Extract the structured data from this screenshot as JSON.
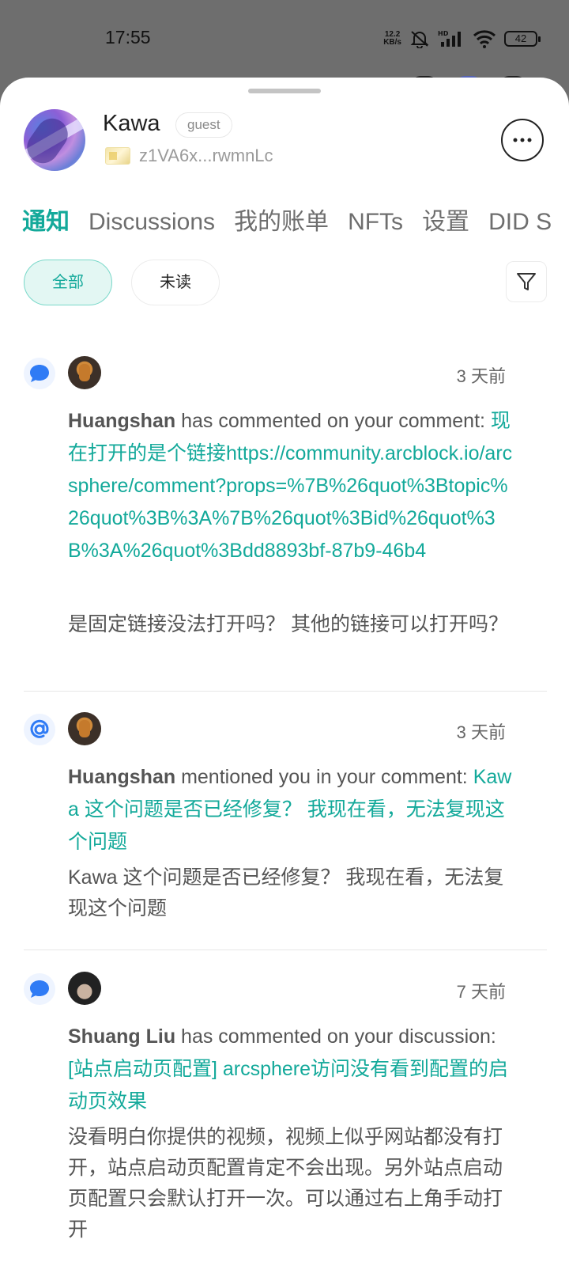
{
  "status_bar": {
    "time": "17:55",
    "net_speed_value": "12.2",
    "net_speed_unit": "KB/s",
    "battery": "42",
    "icons": [
      "mute-bell-icon",
      "hd-signal-icon",
      "wifi-icon",
      "battery-icon"
    ]
  },
  "profile": {
    "name": "Kawa",
    "role": "guest",
    "did_address": "z1VA6x...rwmnLc"
  },
  "tabs": [
    "通知",
    "Discussions",
    "我的账单",
    "NFTs",
    "设置",
    "DID S"
  ],
  "active_tab": "通知",
  "filters": {
    "all_label": "全部",
    "unread_label": "未读",
    "selected": "全部"
  },
  "notifications": [
    {
      "type_icon": "comment-icon",
      "time": "3 天前",
      "actor": "Huangshan",
      "action": " has commented on your comment: ",
      "link_text": "现在打开的是个链接https://community.arcblock.io/arcsphere/comment?props=%7B%26quot%3Btopic%26quot%3B%3A%7B%26quot%3Bid%26quot%3B%3A%26quot%3Bdd8893bf-87b9-46b4",
      "excerpt": "是固定链接没法打开吗？ 其他的链接可以打开吗？"
    },
    {
      "type_icon": "mention-icon",
      "time": "3 天前",
      "actor": "Huangshan",
      "action": " mentioned you in your comment: ",
      "link_text": "Kawa 这个问题是否已经修复？ 我现在看，无法复现这个问题",
      "excerpt": "Kawa 这个问题是否已经修复？ 我现在看，无法复现这个问题"
    },
    {
      "type_icon": "comment-icon",
      "time": "7 天前",
      "actor": "Shuang Liu",
      "action": " has commented on your discussion: ",
      "link_text": "[站点启动页配置] arcsphere访问没有看到配置的启动页效果",
      "excerpt": "没看明白你提供的视频，视频上似乎网站都没有打开，站点启动页配置肯定不会出现。另外站点启动页配置只会默认打开一次。可以通过右上角手动打开"
    }
  ],
  "colors": {
    "accent": "#13a99a",
    "chip_bg": "#e3f7f3",
    "icon_blue": "#2f7bf5",
    "text": "#555555"
  }
}
